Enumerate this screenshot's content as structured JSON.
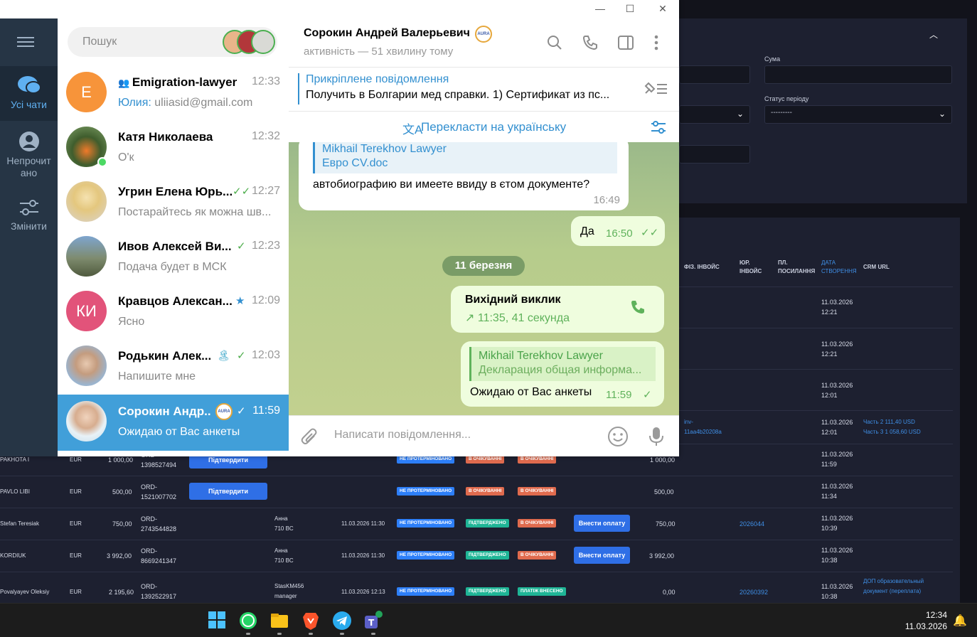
{
  "telegram": {
    "rail": {
      "all_chats": "Усі чати",
      "unread": "Непрочит ано",
      "edit": "Змінити"
    },
    "search": {
      "placeholder": "Пошук"
    },
    "chats": [
      {
        "name": "Emigration-lawyer",
        "time": "12:33",
        "preview_sender": "Юлия:",
        "preview": " uliiasid@gmail.com",
        "avatar_letter": "E",
        "avatar_color": "#f7943a",
        "group": true
      },
      {
        "name": "Катя Николаева",
        "time": "12:32",
        "preview": "О'к",
        "online": true
      },
      {
        "name": "Угрин Елена Юрь...",
        "time": "12:27",
        "preview": "Постарайтесь як можна шв...",
        "read": "double"
      },
      {
        "name": "Ивов Алексей Ви...",
        "time": "12:23",
        "preview": "Подача будет в МСК",
        "read": "single"
      },
      {
        "name": "Кравцов Алексан...",
        "time": "12:09",
        "preview": "Ясно",
        "avatar_letter": "КИ",
        "avatar_color": "#e2537a",
        "pinned_star": true
      },
      {
        "name": "Родькин Алек...",
        "time": "12:03",
        "preview": "Напишите мне",
        "read": "single",
        "emoji": "🏝"
      },
      {
        "name": "Сорокин Андр...",
        "time": "11:59",
        "preview": "Ожидаю от Вас анкеты",
        "read": "single",
        "selected": true
      }
    ],
    "header": {
      "name": "Сорокин Андрей Валерьевич",
      "status": "активність — 51 хвилину тому"
    },
    "pinned": {
      "title": "Прикріплене повідомлення",
      "text": "Получить в Болгарии мед справки.  1) Сертификат из пс..."
    },
    "translate_label": "Перекласти на українську",
    "messages": {
      "m1_reply_name": "Mikhail Terekhov Lawyer",
      "m1_reply_text": "Евро CV.doc",
      "m1_text": "автобиографию ви имеете ввиду в єтом документе?",
      "m1_time": "16:49",
      "m2_text": "Да",
      "m2_time": "16:50",
      "date": "11 березня",
      "call_title": "Вихідний виклик",
      "call_detail": "11:35, 41 секунда",
      "m3_reply_name": "Mikhail Terekhov Lawyer",
      "m3_reply_text": "Декларация общая информа...",
      "m3_text": "Ожидаю от Вас анкеты",
      "m3_time": "11:59"
    },
    "composer": {
      "placeholder": "Написати повідомлення..."
    }
  },
  "crm": {
    "filters": {
      "sum_label": "Сума",
      "period_status_label": "Статус періоду",
      "period_status_value": "---------"
    },
    "headers": [
      "ФІЗ. ІНВОЙС",
      "ЮР. ІНВОЙС",
      "ПЛ. ПОСИЛАННЯ",
      "ДАТА СТВОРЕННЯ",
      "CRM URL"
    ],
    "right_rows": [
      {
        "date": "11.03.2026",
        "time": "12:21"
      },
      {
        "date": "11.03.2026",
        "time": "12:21"
      },
      {
        "date": "11.03.2026",
        "time": "12:01"
      },
      {
        "date": "11.03.2026",
        "time": "12:01",
        "inv": "inv-",
        "inv2": "11aa4b20208a",
        "url1": "Часть 2 111,40 USD",
        "url2": "Часть 3 1 058,60 USD"
      }
    ],
    "rows": [
      {
        "name": "PAKHOTA I",
        "cur": "EUR",
        "amount": "1 000,00",
        "ord1": "ORD-",
        "ord2": "1398527494",
        "btn": "Підтвердити",
        "b1": "НЕ ПРОТЕРМІНОВАНО",
        "b2": "В ОЧІКУВАННІ",
        "b3": "В ОЧІКУВАННІ",
        "total": "1 000,00",
        "date": "11.03.2026",
        "time": "11:59"
      },
      {
        "name": "PAVLO LIBI",
        "cur": "EUR",
        "amount": "500,00",
        "ord1": "ORD-",
        "ord2": "1521007702",
        "btn": "Підтвердити",
        "b1": "НЕ ПРОТЕРМІНОВАНО",
        "b2": "В ОЧІКУВАННІ",
        "b3": "В ОЧІКУВАННІ",
        "total": "500,00",
        "date": "11.03.2026",
        "time": "11:34"
      },
      {
        "name": "Stefan Teresiak",
        "cur": "EUR",
        "amount": "750,00",
        "ord1": "ORD-",
        "ord2": "2743544828",
        "mgr1": "Анна",
        "mgr2": "710 BC",
        "created": "11.03.2026 11:30",
        "b1": "НЕ ПРОТЕРМІНОВАНО",
        "b2": "ПІДТВЕРДЖЕНО",
        "b3": "В ОЧІКУВАННІ",
        "pay": "Внести оплату",
        "total": "750,00",
        "inv": "2026044",
        "date": "11.03.2026",
        "time": "10:39"
      },
      {
        "name": "KORDIUK",
        "cur": "EUR",
        "amount": "3 992,00",
        "ord1": "ORD-",
        "ord2": "8669241347",
        "mgr1": "Анна",
        "mgr2": "710 BC",
        "created": "11.03.2026 11:30",
        "b1": "НЕ ПРОТЕРМІНОВАНО",
        "b2": "ПІДТВЕРДЖЕНО",
        "b3": "В ОЧІКУВАННІ",
        "pay": "Внести оплату",
        "total": "3 992,00",
        "date": "11.03.2026",
        "time": "10:38"
      },
      {
        "name": "Povalyayev Oleksiy",
        "cur": "EUR",
        "amount": "2 195,60",
        "ord1": "ORD-",
        "ord2": "1392522917",
        "mgr1": "StasKM456",
        "mgr2": "manager",
        "created": "11.03.2026 12:13",
        "b1": "НЕ ПРОТЕРМІНОВАНО",
        "b2": "ПІДТВЕРДЖЕНО",
        "b3": "ПЛАТІЖ ВНЕСЕНО",
        "total": "0,00",
        "inv": "20260392",
        "date": "11.03.2026",
        "time": "10:38",
        "url1": "ДОП образовательный",
        "url2": "документ (переплата)"
      }
    ]
  },
  "taskbar": {
    "time": "12:34",
    "date": "11.03.2026"
  }
}
